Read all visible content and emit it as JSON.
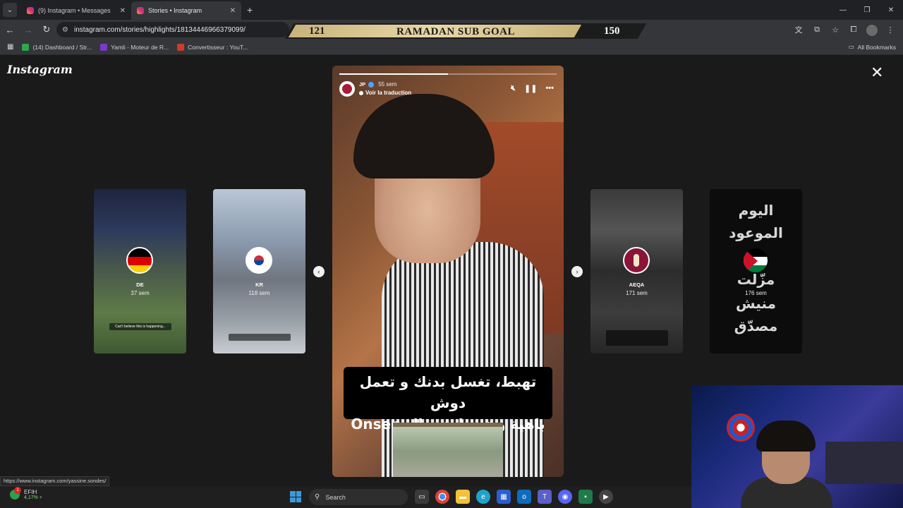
{
  "browser": {
    "tabs": [
      {
        "title": "(9) Instagram • Messages",
        "active": false
      },
      {
        "title": "Stories • Instagram",
        "active": true
      }
    ],
    "url": "instagram.com/stories/highlights/18134446966379099/",
    "bookmarks": [
      {
        "label": "(14) Dashboard / Str...",
        "color": "#2aa84a"
      },
      {
        "label": "Yamli - Moteur de R...",
        "color": "#7a3ac8"
      },
      {
        "label": "Convertisseur : YouT...",
        "color": "#d23a2a"
      }
    ],
    "all_bookmarks": "All Bookmarks"
  },
  "sub_goal": {
    "current": "121",
    "title": "RAMADAN SUB GOAL",
    "target": "150",
    "progress": 0.81
  },
  "instagram": {
    "logo": "Instagram",
    "side_stories": [
      {
        "name": "DE",
        "time": "37 sem",
        "caption": "Can't believe this is happening..."
      },
      {
        "name": "KR",
        "time": "118 sem",
        "caption": ""
      },
      {
        "name": "AEQA",
        "time": "171 sem",
        "caption": ""
      },
      {
        "name": "",
        "time": "176 sem",
        "caption": ""
      }
    ],
    "jordan_lines": [
      "اليوم",
      "الموعود",
      "مزّلت",
      "منيش",
      "مصدّق"
    ],
    "story": {
      "user": "JP",
      "age": "55 sem",
      "translation": "Voir la traduction",
      "caption_line1": "تهبط، تغسل بدنك و تعمل دوش",
      "caption_line2": "باهية و تهبط في ال Onsen 😱",
      "progress": 0.5
    }
  },
  "status_url": "https://www.instagram.com/yassine.sondes/",
  "taskbar": {
    "weather_title": "EFIH",
    "weather_sub": "4,17% +",
    "weather_badge": "1",
    "search": "Search"
  }
}
